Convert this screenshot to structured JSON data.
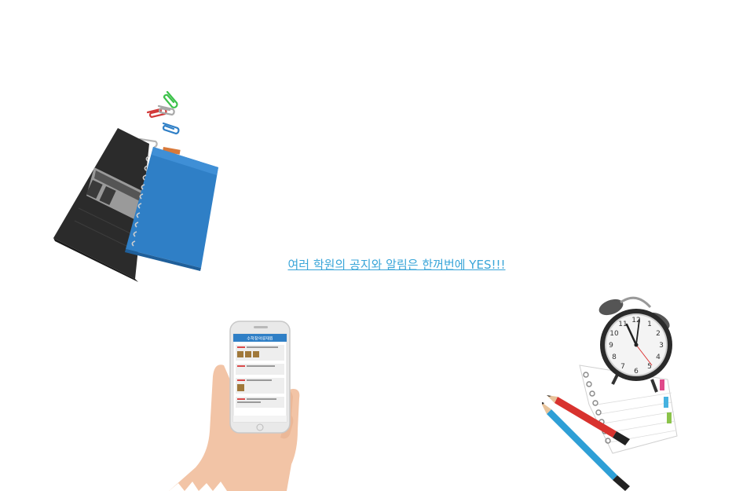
{
  "tagline": {
    "text": "여러 학원의 공지와 알림은 한꺼번에 YES!!!"
  },
  "phone": {
    "app_title": "수학창의영재원"
  },
  "colors": {
    "link": "#39a5d8",
    "notebook_blue": "#2f7fc6",
    "notebook_dark": "#2b2b2b"
  },
  "icons": [
    "paperclip-icon",
    "notebook-icon",
    "phone-icon",
    "alarm-clock-icon",
    "pencil-icon"
  ]
}
